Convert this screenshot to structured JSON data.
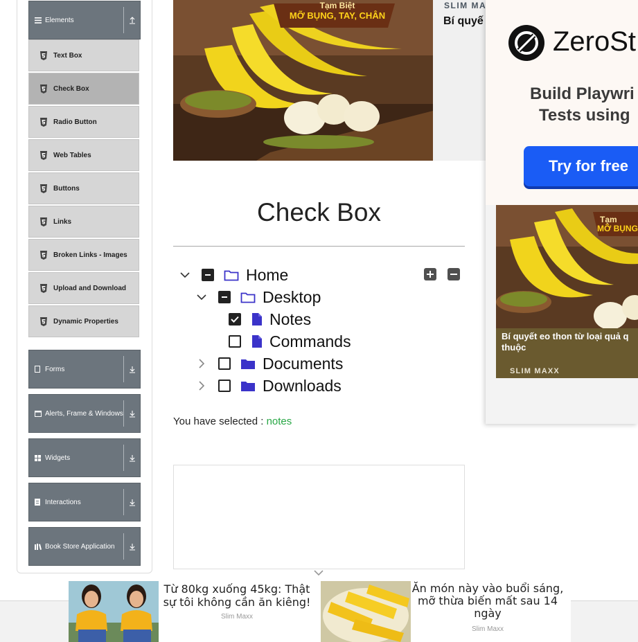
{
  "sidebar": {
    "elements_header": "Elements",
    "items": [
      {
        "label": "Text Box"
      },
      {
        "label": "Check Box"
      },
      {
        "label": "Radio Button"
      },
      {
        "label": "Web Tables"
      },
      {
        "label": "Buttons"
      },
      {
        "label": "Links"
      },
      {
        "label": "Broken Links - Images"
      },
      {
        "label": "Upload and Download"
      },
      {
        "label": "Dynamic Properties"
      }
    ],
    "groups": [
      {
        "label": "Forms"
      },
      {
        "label": "Alerts, Frame & Windows"
      },
      {
        "label": "Widgets"
      },
      {
        "label": "Interactions"
      },
      {
        "label": "Book Store Application"
      }
    ],
    "active_item": "Check Box"
  },
  "hero_ad": {
    "banner_line1": "Tạm Biệt",
    "banner_line2": "MỠ BỤNG, TAY, CHÂN",
    "brand": "SLIM MA",
    "teaser": "Bí quyế"
  },
  "main": {
    "title": "Check Box",
    "tree": {
      "home": "Home",
      "desktop": "Desktop",
      "notes": "Notes",
      "commands": "Commands",
      "documents": "Documents",
      "downloads": "Downloads"
    },
    "result_prefix": "You have selected :",
    "selected": "notes"
  },
  "right_ad": {
    "brand": "ZeroSt",
    "tagline_line1": "Build Playwri",
    "tagline_line2": "Tests using",
    "cta": "Try for free",
    "card_banner1": "Tạm",
    "card_banner2": "MỠ BỤNG,",
    "card_caption": "Bí quyết eo thon từ loại quả q thuộc",
    "card_brand": "SLIM MAXX"
  },
  "bottom_ad": {
    "title1": "Từ 80kg xuống 45kg: Thật sự tôi không cần ăn kiêng!",
    "source1": "Slim Maxx",
    "title2": "Ăn món này vào buổi sáng, mỡ thừa biến mất sau 14 ngày",
    "source2": "Slim Maxx"
  },
  "colors": {
    "sidebar_header": "#6c757d",
    "menu_item": "#d6d6d6",
    "menu_item_active": "#b3b3b3",
    "folder_icon": "#3b33c9",
    "selected_text": "#28a745",
    "cta_button": "#1a5cf5"
  }
}
